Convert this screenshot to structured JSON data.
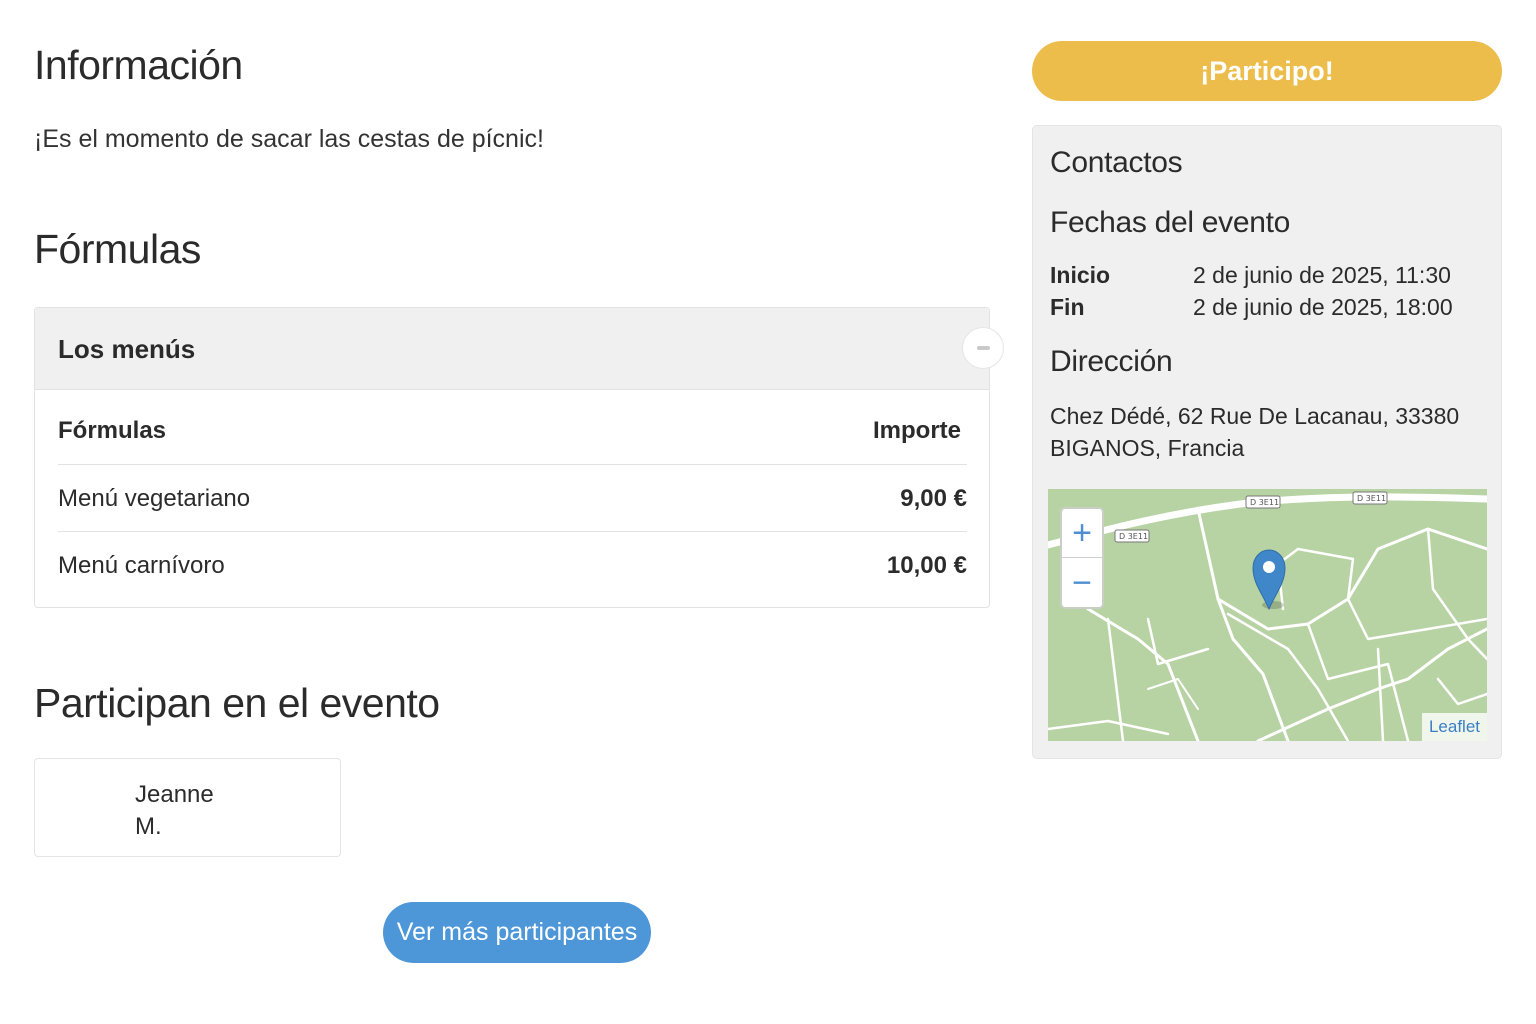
{
  "info": {
    "title": "Información",
    "text": "¡Es el momento de sacar las cestas de pícnic!"
  },
  "formulas": {
    "title": "Fórmulas",
    "card_title": "Los menús",
    "col_formula": "Fórmulas",
    "col_amount": "Importe",
    "rows": [
      {
        "name": "Menú vegetariano",
        "price": "9,00 €"
      },
      {
        "name": "Menú carnívoro",
        "price": "10,00 €"
      }
    ]
  },
  "participants": {
    "title": "Participan en el evento",
    "list": [
      {
        "first": "Jeanne",
        "last": "M."
      }
    ],
    "more_button": "Ver más participantes"
  },
  "sidebar": {
    "participate_button": "¡Participo!",
    "contacts_title": "Contactos",
    "dates_title": "Fechas del evento",
    "start_label": "Inicio",
    "start_value": "2 de junio de 2025, 11:30",
    "end_label": "Fin",
    "end_value": "2 de junio de 2025, 18:00",
    "address_title": "Dirección",
    "address_line1": "Chez Dédé, 62 Rue De Lacanau, 33380",
    "address_line2": "BIGANOS, Francia",
    "map": {
      "zoom_in": "+",
      "zoom_out": "−",
      "attribution": "Leaflet",
      "road_labels": [
        "D 3E11",
        "D 3E11",
        "D 3E11"
      ],
      "marker_icon": "map-marker-icon"
    }
  },
  "colors": {
    "participate": "#ecbd4b",
    "more_button": "#4d97d9",
    "panel_bg": "#f0f0f1",
    "map_bg": "#b8d3a3"
  }
}
